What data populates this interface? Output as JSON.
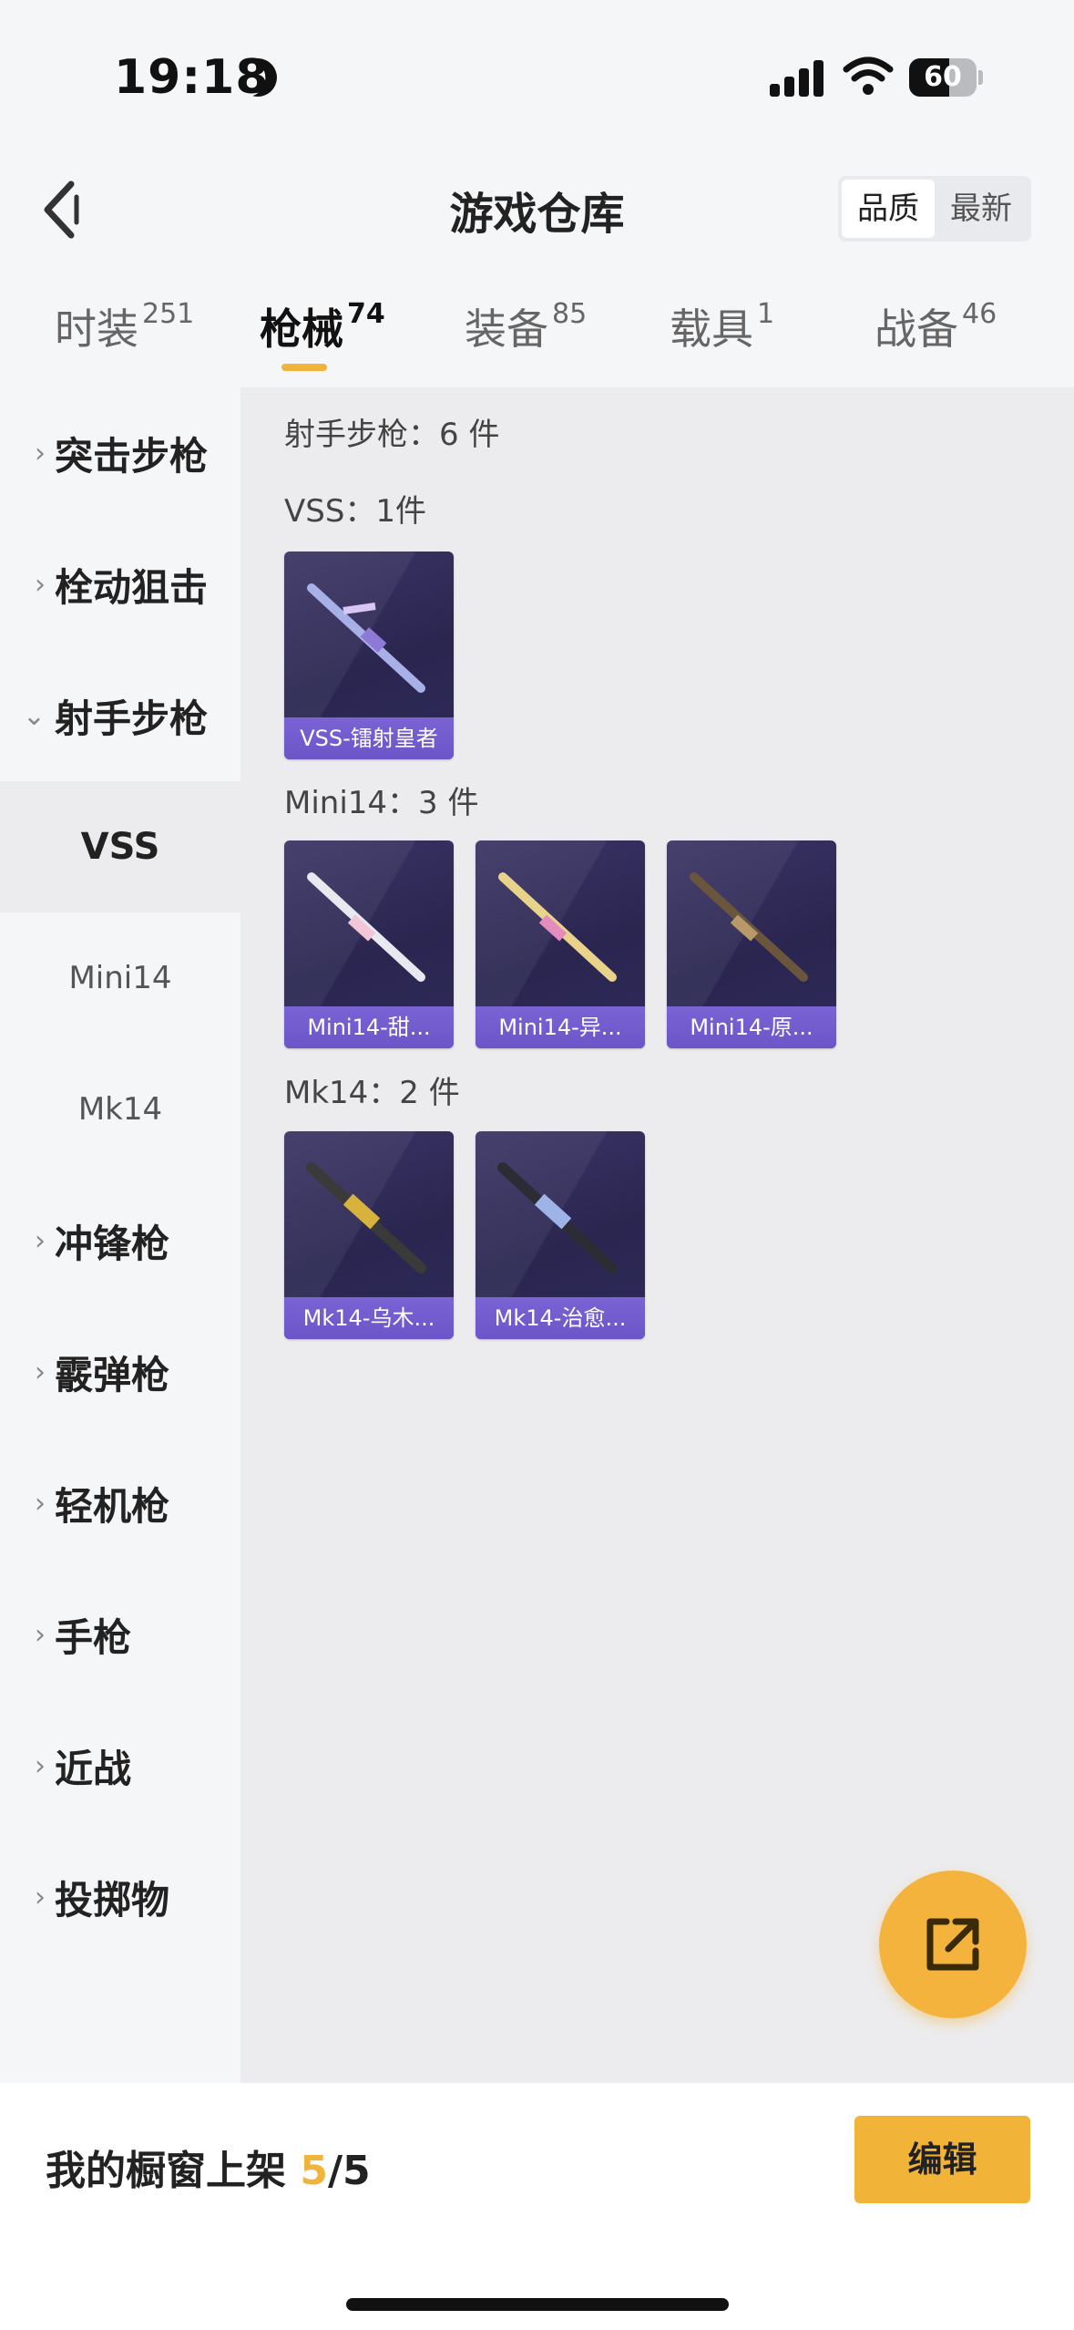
{
  "status": {
    "time": "19:18",
    "battery": "60",
    "battery_level": 0.6
  },
  "header": {
    "title": "游戏仓库",
    "sort_options": [
      "品质",
      "最新"
    ],
    "sort_active": 0
  },
  "category_tabs": [
    {
      "label": "时装",
      "count": "251"
    },
    {
      "label": "枪械",
      "count": "74"
    },
    {
      "label": "装备",
      "count": "85"
    },
    {
      "label": "载具",
      "count": "1"
    },
    {
      "label": "战备",
      "count": "46"
    }
  ],
  "active_tab": 1,
  "sidebar": {
    "items": [
      {
        "label": "突击步枪"
      },
      {
        "label": "栓动狙击"
      },
      {
        "label": "射手步枪"
      },
      {
        "label": "冲锋枪"
      },
      {
        "label": "霰弹枪"
      },
      {
        "label": "轻机枪"
      },
      {
        "label": "手枪"
      },
      {
        "label": "近战"
      },
      {
        "label": "投掷物"
      }
    ],
    "subitems": [
      {
        "label": "VSS"
      },
      {
        "label": "Mini14"
      },
      {
        "label": "Mk14"
      }
    ]
  },
  "main": {
    "category_header": "射手步枪：6 件",
    "groups": [
      {
        "title": "VSS：1件",
        "items": [
          {
            "name": "VSS-镭射皇者"
          }
        ]
      },
      {
        "title": "Mini14：3 件",
        "items": [
          {
            "name": "Mini14-甜..."
          },
          {
            "name": "Mini14-异..."
          },
          {
            "name": "Mini14-原..."
          }
        ]
      },
      {
        "title": "Mk14：2 件",
        "items": [
          {
            "name": "Mk14-乌木..."
          },
          {
            "name": "Mk14-治愈..."
          }
        ]
      }
    ]
  },
  "bottom": {
    "showcase_label": "我的橱窗上架 ",
    "showcase_current": "5",
    "showcase_total": "/5",
    "edit_label": "编辑"
  }
}
